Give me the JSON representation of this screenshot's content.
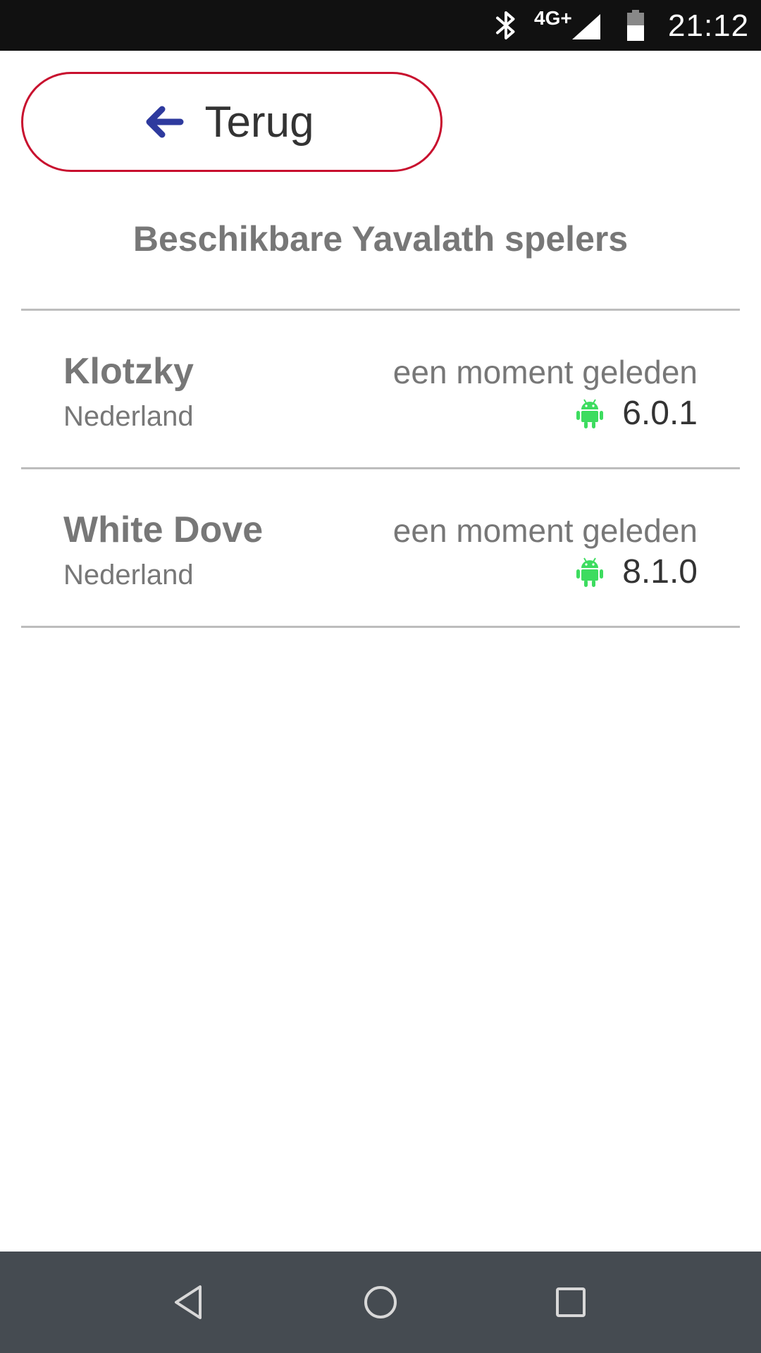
{
  "status_bar": {
    "network": "4G+",
    "time": "21:12",
    "icons": [
      "bluetooth-icon",
      "signal-icon",
      "battery-icon"
    ]
  },
  "back_button": {
    "label": "Terug",
    "icon": "arrow-left-icon"
  },
  "title": "Beschikbare Yavalath spelers",
  "players": [
    {
      "name": "Klotzky",
      "country": "Nederland",
      "last_seen": "een moment geleden",
      "platform_icon": "android-icon",
      "version": "6.0.1"
    },
    {
      "name": "White Dove",
      "country": "Nederland",
      "last_seen": "een moment geleden",
      "platform_icon": "android-icon",
      "version": "8.1.0"
    }
  ],
  "nav_bar": {
    "buttons": [
      "nav-back-icon",
      "nav-home-icon",
      "nav-recents-icon"
    ]
  },
  "colors": {
    "accent_border": "#c8102e",
    "arrow": "#2e3a9e",
    "android": "#3ddc5f",
    "nav_bar": "#454b51",
    "status_bar": "#111111"
  }
}
